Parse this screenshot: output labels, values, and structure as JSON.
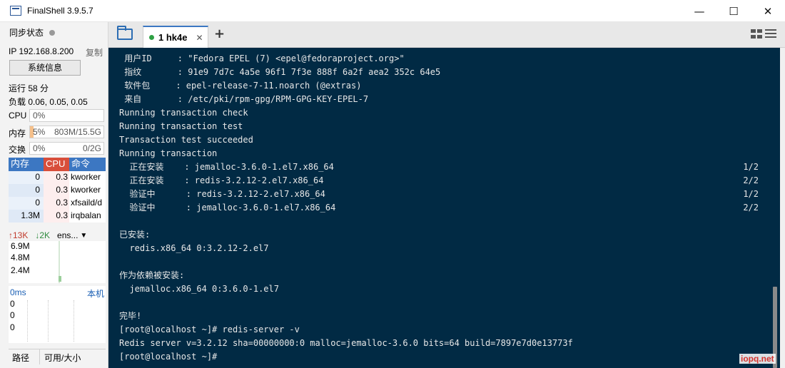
{
  "window": {
    "title": "FinalShell 3.9.5.7",
    "controls": [
      "—",
      "☐",
      "✕"
    ]
  },
  "sidebar": {
    "sync_label": "同步状态",
    "ip": "IP 192.168.8.200",
    "copy_label": "复制",
    "sysinfo_button": "系统信息",
    "uptime": "运行 58 分",
    "load": "负载 0.06, 0.05, 0.05",
    "cpu": {
      "label": "CPU",
      "value": "0%",
      "fraction": 0.0
    },
    "mem": {
      "label": "内存",
      "percent": "5%",
      "detail": "803M/15.5G",
      "fraction": 0.05
    },
    "swap": {
      "label": "交换",
      "percent": "0%",
      "detail": "0/2G",
      "fraction": 0.0
    },
    "process_headers": [
      "内存",
      "CPU",
      "命令"
    ],
    "processes": [
      {
        "mem": "0",
        "cpu": "0.3",
        "cmd": "kworker"
      },
      {
        "mem": "0",
        "cpu": "0.3",
        "cmd": "kworker"
      },
      {
        "mem": "0",
        "cpu": "0.3",
        "cmd": "xfsaild/d"
      },
      {
        "mem": "1.3M",
        "cpu": "0.3",
        "cmd": "irqbalan"
      }
    ],
    "net": {
      "up": "↑13K",
      "down": "↓2K",
      "iface": "ens...",
      "caret": "▼"
    },
    "net_scale": [
      "6.9M",
      "4.8M",
      "2.4M"
    ],
    "ping": {
      "latency": "0ms",
      "host": "本机",
      "values": [
        "0",
        "0",
        "0"
      ]
    },
    "file_headers": [
      "路径",
      "可用/大小"
    ]
  },
  "tabs": {
    "active": {
      "label": "1 hk4e",
      "close": "✕"
    },
    "add": "+",
    "layout_icon": "grid-icon",
    "menu_icon": "menu-icon"
  },
  "terminal": {
    "lines": [
      {
        "text": " 用户ID     : \"Fedora EPEL (7) <epel@fedoraproject.org>\"",
        "right": ""
      },
      {
        "text": " 指纹       : 91e9 7d7c 4a5e 96f1 7f3e 888f 6a2f aea2 352c 64e5",
        "right": ""
      },
      {
        "text": " 软件包     : epel-release-7-11.noarch (@extras)",
        "right": ""
      },
      {
        "text": " 来自       : /etc/pki/rpm-gpg/RPM-GPG-KEY-EPEL-7",
        "right": ""
      },
      {
        "text": "Running transaction check",
        "right": ""
      },
      {
        "text": "Running transaction test",
        "right": ""
      },
      {
        "text": "Transaction test succeeded",
        "right": ""
      },
      {
        "text": "Running transaction",
        "right": ""
      },
      {
        "text": "  正在安装    : jemalloc-3.6.0-1.el7.x86_64",
        "right": "1/2"
      },
      {
        "text": "  正在安装    : redis-3.2.12-2.el7.x86_64",
        "right": "2/2"
      },
      {
        "text": "  验证中      : redis-3.2.12-2.el7.x86_64",
        "right": "1/2"
      },
      {
        "text": "  验证中      : jemalloc-3.6.0-1.el7.x86_64",
        "right": "2/2"
      },
      {
        "text": "",
        "right": ""
      },
      {
        "text": "已安装:",
        "right": ""
      },
      {
        "text": "  redis.x86_64 0:3.2.12-2.el7",
        "right": ""
      },
      {
        "text": "",
        "right": ""
      },
      {
        "text": "作为依赖被安装:",
        "right": ""
      },
      {
        "text": "  jemalloc.x86_64 0:3.6.0-1.el7",
        "right": ""
      },
      {
        "text": "",
        "right": ""
      },
      {
        "text": "完毕!",
        "right": ""
      },
      {
        "text": "[root@localhost ~]# redis-server -v",
        "right": ""
      },
      {
        "text": "Redis server v=3.2.12 sha=00000000:0 malloc=jemalloc-3.6.0 bits=64 build=7897e7d0e13773f",
        "right": ""
      },
      {
        "text": "[root@localhost ~]#",
        "right": ""
      }
    ]
  },
  "watermark": "iopq.net",
  "colors": {
    "terminal_bg": "#012a44",
    "terminal_fg": "#e7e7e7",
    "accent": "#3c77c2",
    "cpu_header": "#d84e3b",
    "tab_active_dot": "#2ea043"
  }
}
